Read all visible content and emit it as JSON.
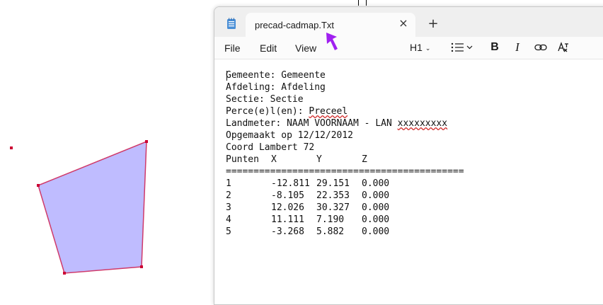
{
  "cad": {
    "polygon_fill": "#bfbcff",
    "polygon_stroke": "#d03a6a",
    "vertex_color": "#cc0033"
  },
  "notepad": {
    "tab_title": "precad-cadmap.Txt",
    "close_glyph": "×",
    "new_tab_glyph": "+",
    "menus": [
      "File",
      "Edit",
      "View"
    ],
    "toolbar": {
      "heading_label": "H1"
    },
    "cursor_color": "#a020f0",
    "lines": {
      "gemeente": "Gemeente: Gemeente",
      "afdeling": "Afdeling: Afdeling",
      "sectie": "Sectie: Sectie",
      "perceel_prefix": "Perce(e)l(en): ",
      "perceel_value": "Preceel",
      "landmeter_prefix": "Landmeter: NAAM VOORNAAM - LAN ",
      "landmeter_value": "xxxxxxxxx",
      "opgemaakt": "Opgemaakt op 12/12/2012",
      "coord": "Coord Lambert 72",
      "separator": "==========================================="
    },
    "table_header": {
      "punten": "Punten",
      "x": "X",
      "y": "Y",
      "z": "Z"
    },
    "points": [
      {
        "id": "1",
        "x": "-12.811",
        "y": "29.151",
        "z": "0.000"
      },
      {
        "id": "2",
        "x": "-8.105",
        "y": "22.353",
        "z": "0.000"
      },
      {
        "id": "3",
        "x": "12.026",
        "y": "30.327",
        "z": "0.000"
      },
      {
        "id": "4",
        "x": "11.111",
        "y": "7.190",
        "z": "0.000"
      },
      {
        "id": "5",
        "x": "-3.268",
        "y": "5.882",
        "z": "0.000"
      }
    ]
  }
}
